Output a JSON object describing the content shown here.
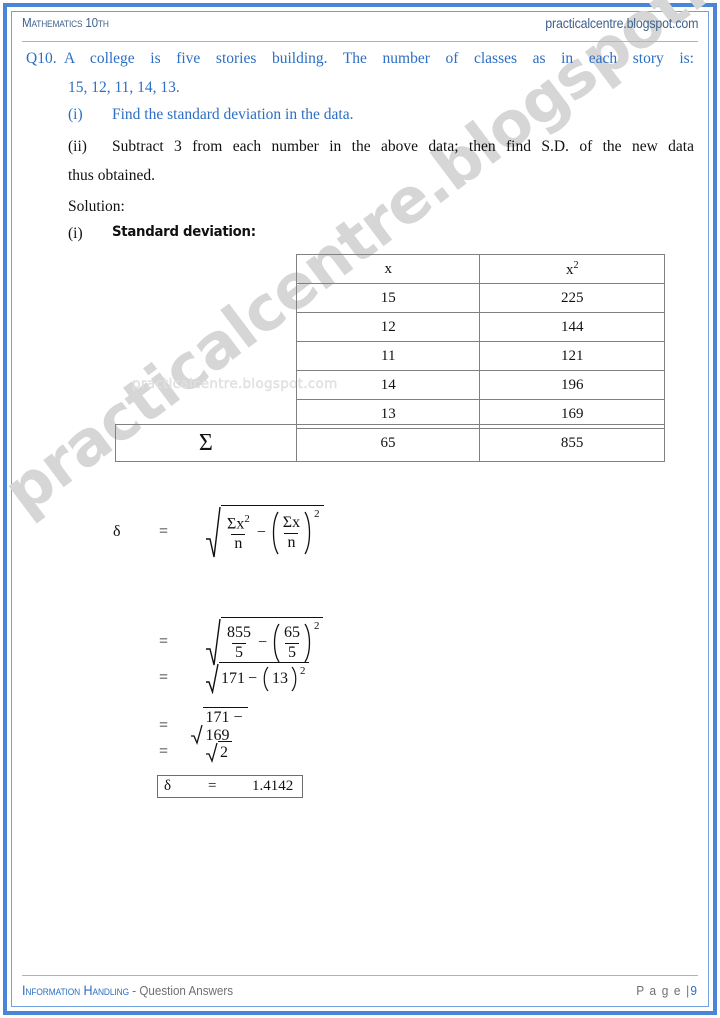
{
  "header": {
    "subject": "Mathematics 10th",
    "site": "practicalcentre.blogspot.com"
  },
  "watermark": {
    "diagonal": "practicalcentre.blogspot.com",
    "inline": "practicalcentre.blogspot.com"
  },
  "question": {
    "number": "Q10.",
    "text": "A college is five stories building. The number of classes as in each story is:",
    "data": "15, 12, 11, 14, 13.",
    "part_i_label": "(i)",
    "part_i_text": "Find the standard deviation in the data.",
    "part_ii_label": "(ii)",
    "part_ii_text": "Subtract 3 from each number in the above data; then find S.D. of the new data",
    "part_ii_text_cont": "thus obtained."
  },
  "solution": {
    "label": "Solution:",
    "step_label": "(i)",
    "step_title": "Standard deviation:"
  },
  "table": {
    "headers": [
      "x",
      "x2"
    ],
    "header_x": "x",
    "header_x2_base": "x",
    "header_x2_exp": "2",
    "rows": [
      {
        "x": "15",
        "x2": "225"
      },
      {
        "x": "12",
        "x2": "144"
      },
      {
        "x": "11",
        "x2": "121"
      },
      {
        "x": "14",
        "x2": "196"
      },
      {
        "x": "13",
        "x2": "169"
      }
    ],
    "sum_symbol": "Σ",
    "sum_x": "65",
    "sum_x2": "855"
  },
  "math": {
    "delta": "δ",
    "equals": "=",
    "minus": "−",
    "sigma": "Σ",
    "step1": {
      "num_sigma_x2_base": "x",
      "num_sigma_x2_exp": "2",
      "den_n": "n",
      "num2_x": "x",
      "den2_n": "n",
      "outer_exp": "2"
    },
    "step2": {
      "num": "855",
      "den": "5",
      "num2": "65",
      "den2": "5",
      "exp": "2"
    },
    "step3": {
      "left": "171",
      "inner": "13",
      "exp": "2"
    },
    "step4": {
      "expr": "171 − 169"
    },
    "step5": {
      "expr": "2"
    },
    "result": {
      "symbol": "δ",
      "equals": "=",
      "value": "1.4142"
    }
  },
  "footer": {
    "chapter": "Information Handling",
    "subtitle": " - Question Answers",
    "page_label": "P a g e |",
    "page_number": "9"
  },
  "colors": {
    "border_blue": "#4a86d8",
    "question_blue": "#2c6fc4",
    "header_blue": "#41628d",
    "watermark_gray": "#d6d6d6"
  }
}
